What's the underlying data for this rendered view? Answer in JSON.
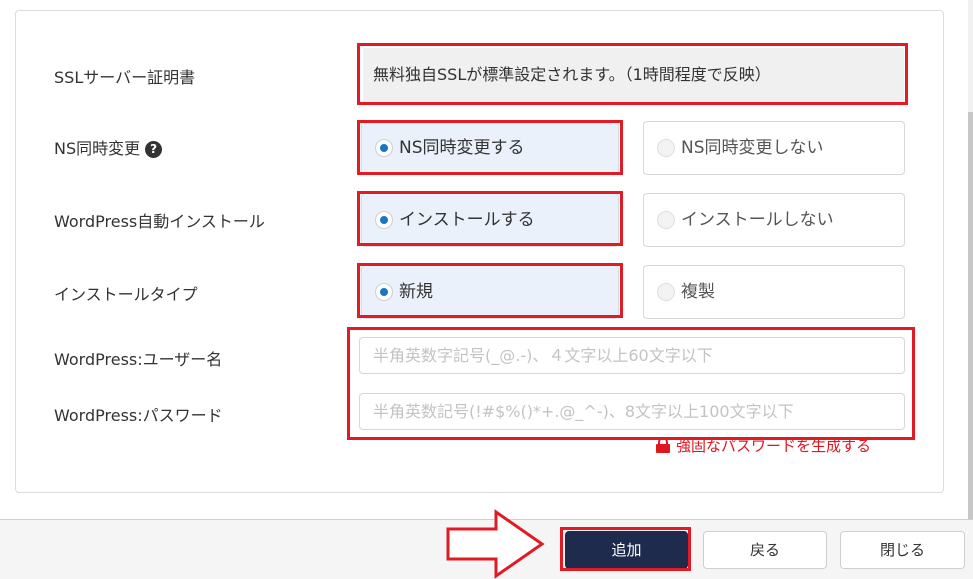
{
  "form": {
    "ssl": {
      "label": "SSLサーバー証明書",
      "value": "無料独自SSLが標準設定されます。（1時間程度で反映）"
    },
    "ns": {
      "label": "NS同時変更",
      "help_glyph": "?",
      "options": [
        {
          "label": "NS同時変更する",
          "selected": true
        },
        {
          "label": "NS同時変更しない",
          "selected": false
        }
      ]
    },
    "wp_auto_install": {
      "label": "WordPress自動インストール",
      "options": [
        {
          "label": "インストールする",
          "selected": true
        },
        {
          "label": "インストールしない",
          "selected": false
        }
      ]
    },
    "install_type": {
      "label": "インストールタイプ",
      "options": [
        {
          "label": "新規",
          "selected": true
        },
        {
          "label": "複製",
          "selected": false
        }
      ]
    },
    "wp_username": {
      "label": "WordPress:ユーザー名",
      "value": "",
      "placeholder": "半角英数字記号(_@.-)、４文字以上60文字以下"
    },
    "wp_password": {
      "label": "WordPress:パスワード",
      "value": "",
      "placeholder": "半角英数記号(!#$%()*+.@_^-)、8文字以上100文字以下"
    },
    "generate_password_link": "強固なパスワードを生成する"
  },
  "footer": {
    "add_label": "追加",
    "back_label": "戻る",
    "close_label": "閉じる"
  },
  "icons": {
    "help": "question-circle-icon",
    "lock": "lock-icon",
    "arrow": "right-arrow-icon"
  },
  "colors": {
    "highlight": "#e21a23",
    "primary_button": "#1f2b4d",
    "radio_selected": "#1b74c8",
    "selected_option_bg": "#eaf1fb",
    "link_red": "#e0171f"
  }
}
